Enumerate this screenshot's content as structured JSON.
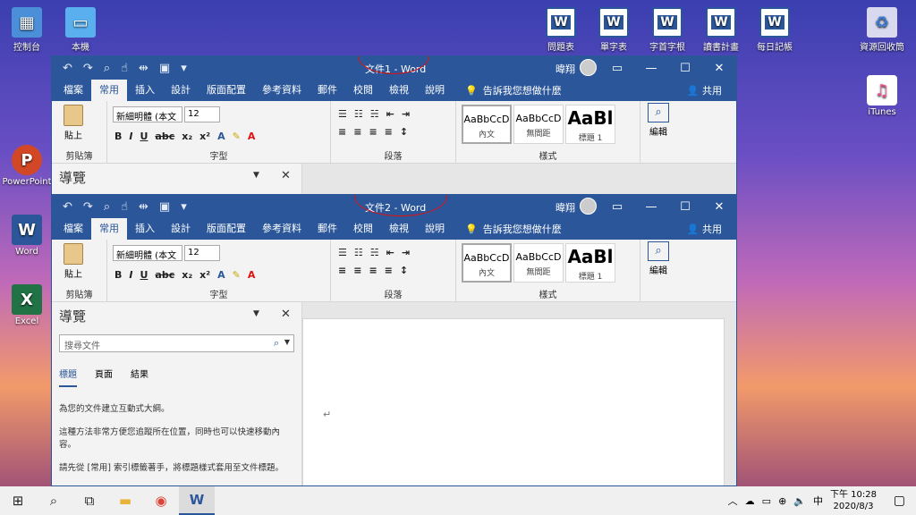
{
  "desktop": {
    "icons": [
      {
        "label": "控制台",
        "icon": "control-panel-icon"
      },
      {
        "label": "本機",
        "icon": "this-pc-icon"
      },
      {
        "label": "問題表",
        "icon": "word-doc-icon"
      },
      {
        "label": "單字表",
        "icon": "word-doc-icon"
      },
      {
        "label": "字首字根",
        "icon": "word-doc-icon"
      },
      {
        "label": "讀書計畫",
        "icon": "word-doc-icon"
      },
      {
        "label": "每日記帳",
        "icon": "word-doc-icon"
      },
      {
        "label": "資源回收筒",
        "icon": "recycle-bin-icon"
      },
      {
        "label": "iTunes",
        "icon": "itunes-icon"
      },
      {
        "label": "PowerPoint",
        "icon": "powerpoint-icon"
      },
      {
        "label": "Word",
        "icon": "word-icon"
      },
      {
        "label": "Excel",
        "icon": "excel-icon"
      }
    ]
  },
  "window1": {
    "title": "文件1 - Word",
    "nav_title": "導覽"
  },
  "window2": {
    "title": "文件2 - Word",
    "nav_title": "導覽",
    "search_placeholder": "搜尋文件",
    "nav_tabs": [
      "標題",
      "頁面",
      "結果"
    ],
    "nav_text": [
      "為您的文件建立互動式大綱。",
      "這種方法非常方便您追蹤所在位置，同時也可以快速移動內容。",
      "請先從 [常用] 索引標籤著手，將標題樣式套用至文件標題。"
    ]
  },
  "common": {
    "user_name": "暐翔",
    "tabs": [
      "檔案",
      "常用",
      "插入",
      "設計",
      "版面配置",
      "參考資料",
      "郵件",
      "校閱",
      "檢視",
      "說明"
    ],
    "tell_me": "告訴我您想做什麼",
    "share": "共用",
    "paste": "貼上",
    "font_name": "新細明體 (本文",
    "font_size": "12",
    "group_clipboard": "剪貼簿",
    "group_font": "字型",
    "group_paragraph": "段落",
    "group_styles": "樣式",
    "styles": [
      {
        "preview": "AaBbCcD",
        "name": "內文"
      },
      {
        "preview": "AaBbCcD",
        "name": "無間距"
      },
      {
        "preview": "AaBl",
        "name": "標題 1"
      }
    ],
    "edit_label": "編輯"
  },
  "taskbar": {
    "time": "下午 10:28",
    "date": "2020/8/3",
    "ime": "中"
  },
  "colors": {
    "word_blue": "#2b579a",
    "annotation_red": "#e01010"
  }
}
